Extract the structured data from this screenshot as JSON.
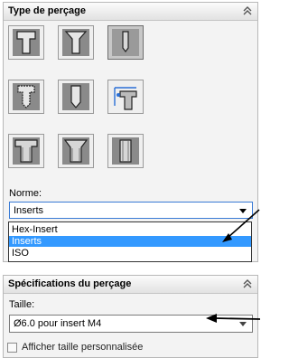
{
  "hole_type_panel": {
    "title": "Type de perçage",
    "collapse_icon": "chevron-double-up-icon",
    "buttons": [
      {
        "name": "counterbore",
        "icon": "counterbore-hole-icon",
        "selected": false
      },
      {
        "name": "countersink",
        "icon": "countersink-hole-icon",
        "selected": false
      },
      {
        "name": "simple-hole",
        "icon": "simple-hole-icon",
        "selected": true
      },
      {
        "name": "tapped",
        "icon": "tapped-hole-icon",
        "selected": false
      },
      {
        "name": "drilled",
        "icon": "drilled-hole-icon",
        "selected": false
      },
      {
        "name": "advanced",
        "icon": "advanced-hole-icon",
        "selected": false
      },
      {
        "name": "slot-counterbore",
        "icon": "slot-counterbore-icon",
        "selected": false
      },
      {
        "name": "slot-countersink",
        "icon": "slot-countersink-icon",
        "selected": false
      },
      {
        "name": "slot",
        "icon": "slot-icon",
        "selected": false
      }
    ],
    "norme_label": "Norme:",
    "norme_value": "Inserts",
    "norme_options": [
      "Hex-Insert",
      "Inserts",
      "ISO"
    ],
    "norme_selected_index": 1
  },
  "spec_panel": {
    "title": "Spécifications du perçage",
    "collapse_icon": "chevron-double-up-icon",
    "taille_label": "Taille:",
    "taille_value": "Ø6.0 pour insert M4",
    "custom_size_label": "Afficher taille personnalisée",
    "custom_size_checked": false
  },
  "colors": {
    "accent": "#3399ff",
    "panel_bg": "#f3f3f3",
    "selected_button": "#c7c7c7"
  }
}
